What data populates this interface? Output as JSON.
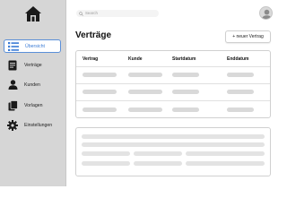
{
  "sidebar": {
    "items": [
      {
        "label": "Übersicht",
        "icon": "list-icon",
        "active": true
      },
      {
        "label": "Verträge",
        "icon": "contract-icon",
        "active": false
      },
      {
        "label": "Kunden",
        "icon": "person-icon",
        "active": false
      },
      {
        "label": "Vorlagen",
        "icon": "copy-icon",
        "active": false
      },
      {
        "label": "Einstellungen",
        "icon": "gear-icon",
        "active": false
      }
    ]
  },
  "header": {
    "search_placeholder": "Search"
  },
  "main": {
    "title": "Verträge",
    "new_button_label": "+ neuer Vertrag",
    "table": {
      "columns": [
        "Vertrag",
        "Kunde",
        "Startdatum",
        "Enddatum"
      ]
    }
  },
  "colors": {
    "accent": "#3a7bd5",
    "sidebar_bg": "#d6d6d6",
    "placeholder": "#d9d9d9"
  }
}
